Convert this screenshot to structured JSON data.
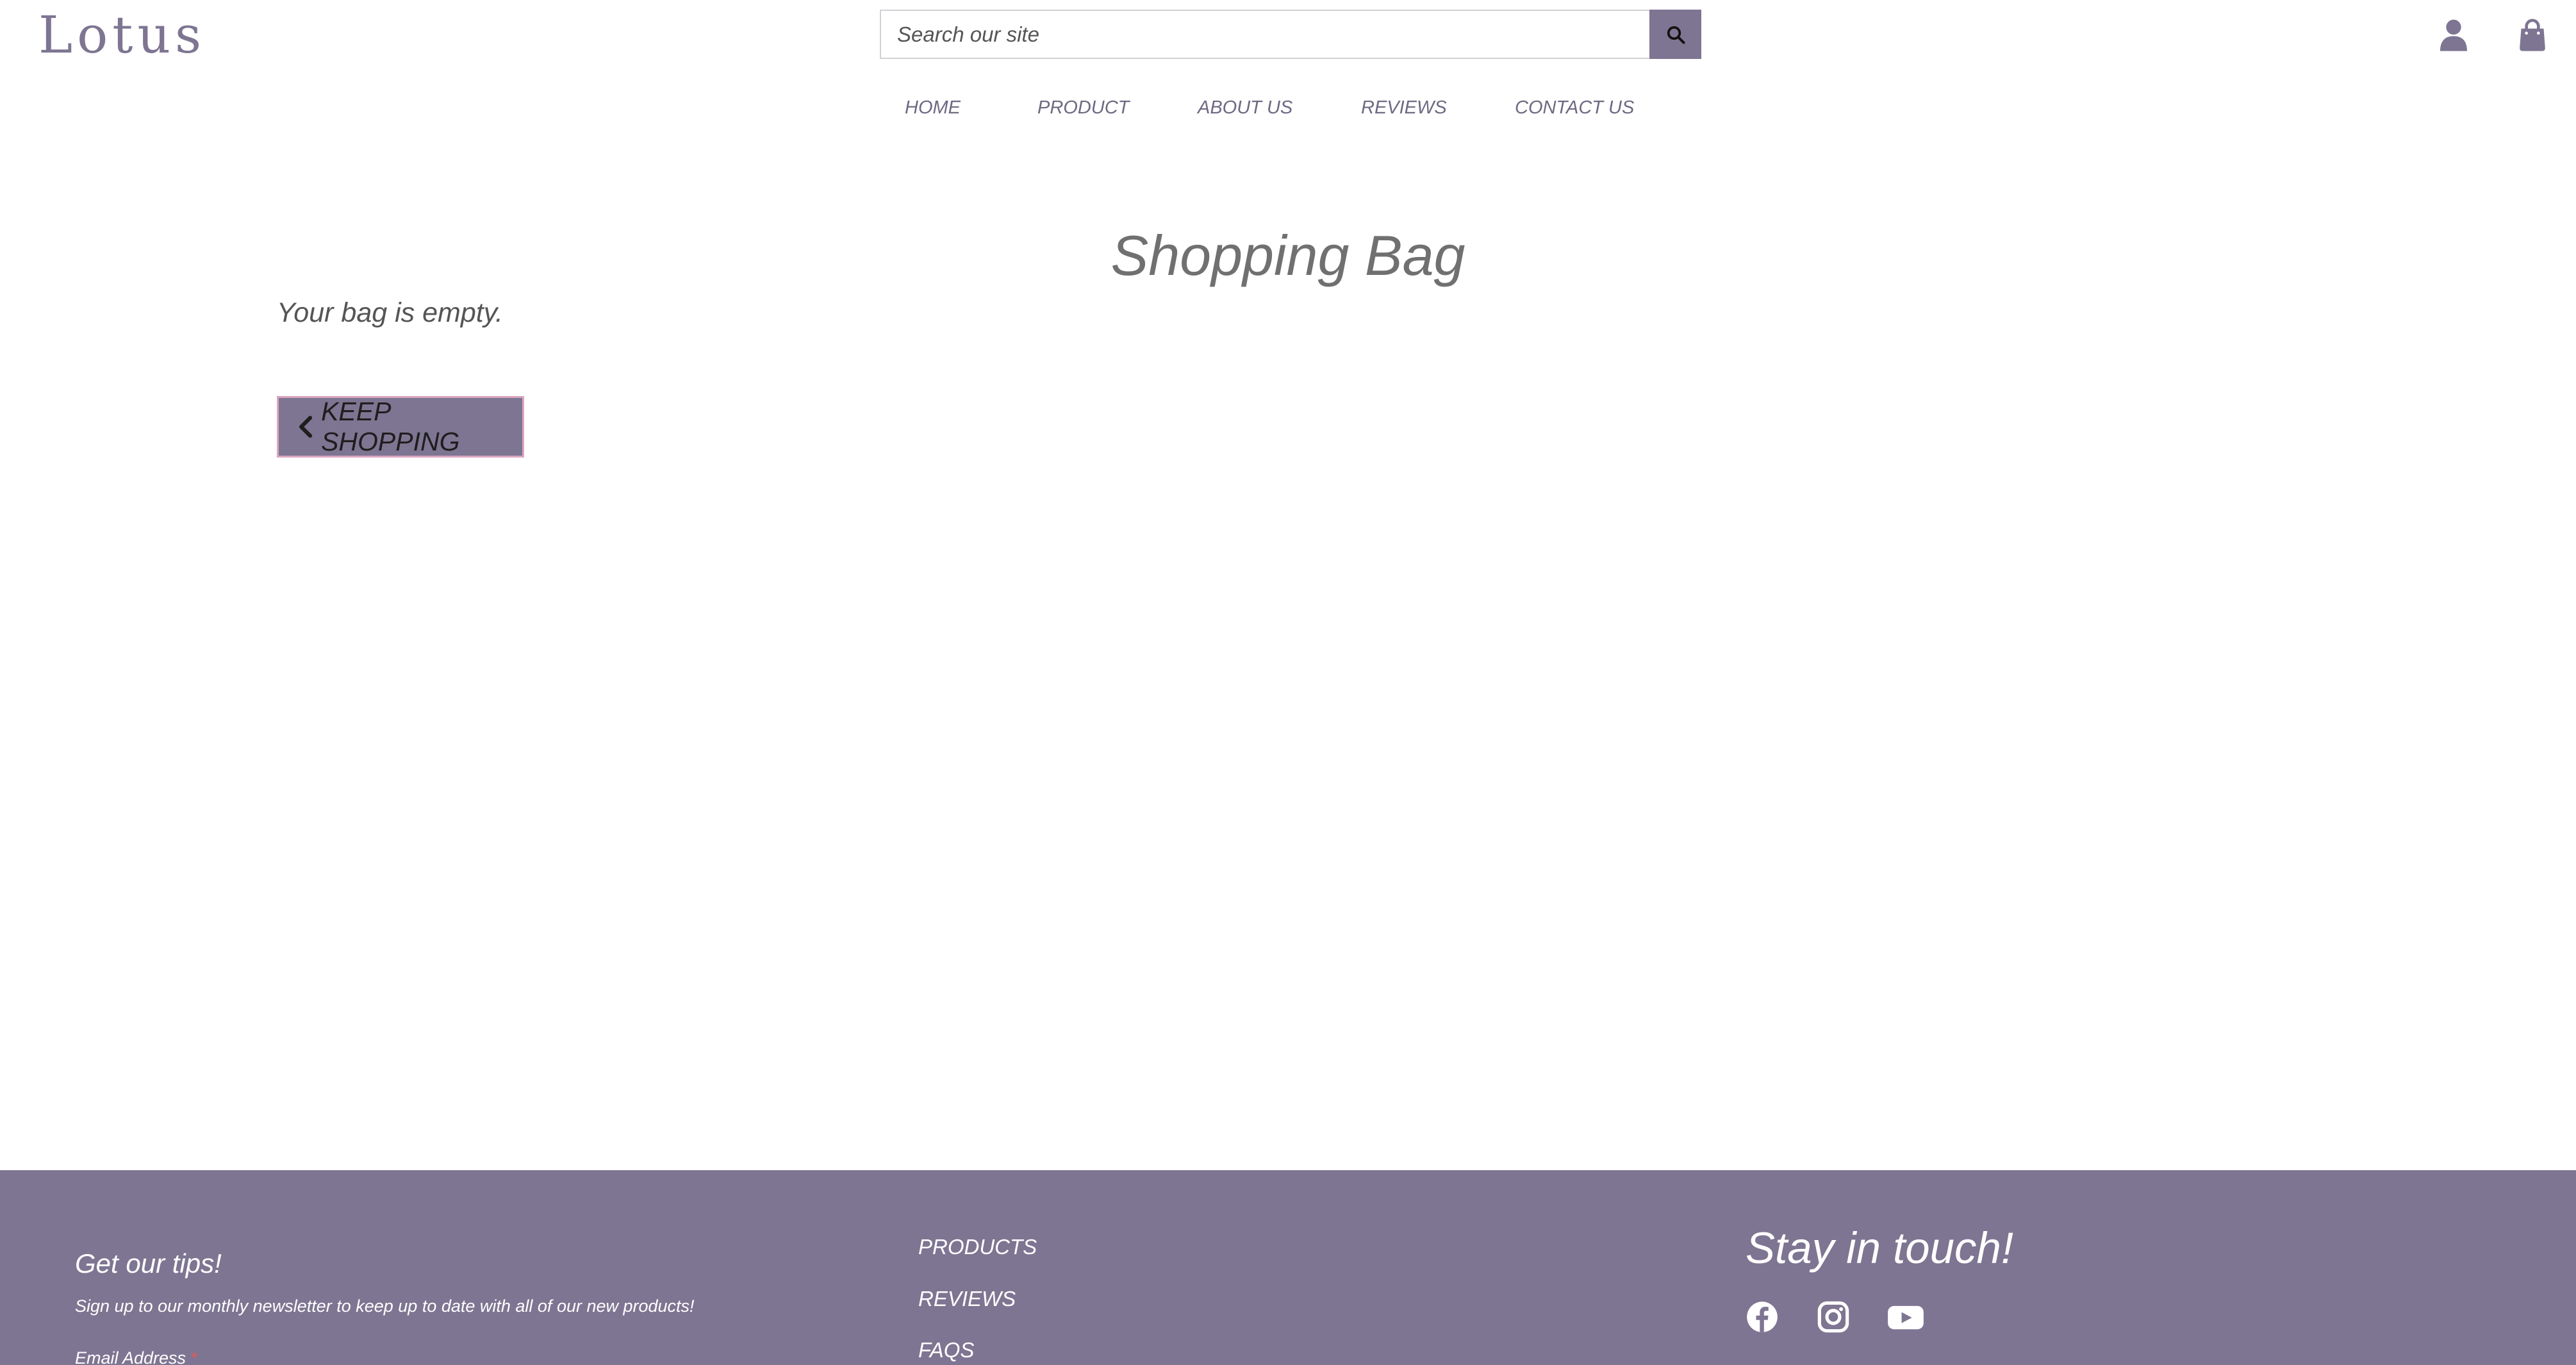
{
  "brand": {
    "name": "Lotus"
  },
  "search": {
    "placeholder": "Search our site"
  },
  "nav": {
    "items": [
      "HOME",
      "PRODUCT",
      "ABOUT US",
      "REVIEWS",
      "CONTACT US"
    ]
  },
  "cart": {
    "title": "Shopping Bag",
    "empty_message": "Your bag is empty.",
    "keep_shopping_label": "KEEP SHOPPING"
  },
  "footer": {
    "newsletter_title": "Get our tips!",
    "newsletter_text": "Sign up to our monthly newsletter to keep up to date with all of our new products!",
    "email_label": "Email Address",
    "email_required_mark": "*",
    "links": [
      "PRODUCTS",
      "REVIEWS",
      "FAQS"
    ],
    "stay_title": "Stay in touch!",
    "social_icons": [
      "facebook-icon",
      "instagram-icon",
      "youtube-icon"
    ]
  },
  "colors": {
    "accent": "#7e7592",
    "text": "#555555",
    "title": "#707070",
    "button_border": "#dba6c0"
  }
}
